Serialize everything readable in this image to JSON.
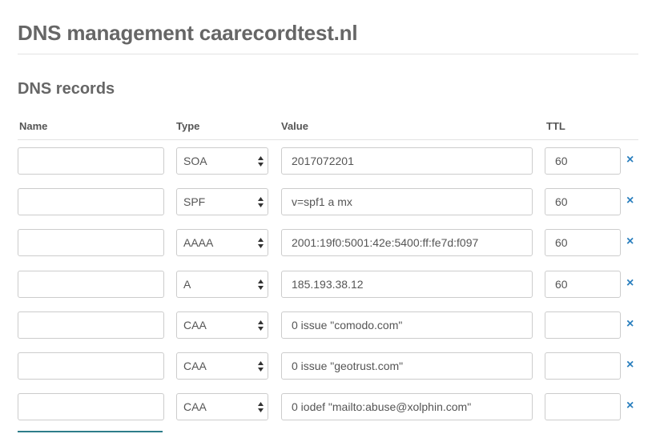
{
  "page": {
    "title": "DNS management caarecordtest.nl",
    "section_title": "DNS records"
  },
  "table": {
    "headers": {
      "name": "Name",
      "type": "Type",
      "value": "Value",
      "ttl": "TTL"
    },
    "rows": [
      {
        "name": "",
        "type": "SOA",
        "value": "2017072201",
        "ttl": "60"
      },
      {
        "name": "",
        "type": "SPF",
        "value": "v=spf1 a mx",
        "ttl": "60"
      },
      {
        "name": "",
        "type": "AAAA",
        "value": "2001:19f0:5001:42e:5400:ff:fe7d:f097",
        "ttl": "60"
      },
      {
        "name": "",
        "type": "A",
        "value": "185.193.38.12",
        "ttl": "60"
      },
      {
        "name": "",
        "type": "CAA",
        "value": "0 issue \"comodo.com\"",
        "ttl": ""
      },
      {
        "name": "",
        "type": "CAA",
        "value": "0 issue \"geotrust.com\"",
        "ttl": ""
      },
      {
        "name": "",
        "type": "CAA",
        "value": "0 iodef \"mailto:abuse@xolphin.com\"",
        "ttl": ""
      }
    ],
    "delete_icon": "×"
  },
  "colors": {
    "accent": "#2a7fbe",
    "text": "#555555",
    "border": "#cccccc"
  }
}
